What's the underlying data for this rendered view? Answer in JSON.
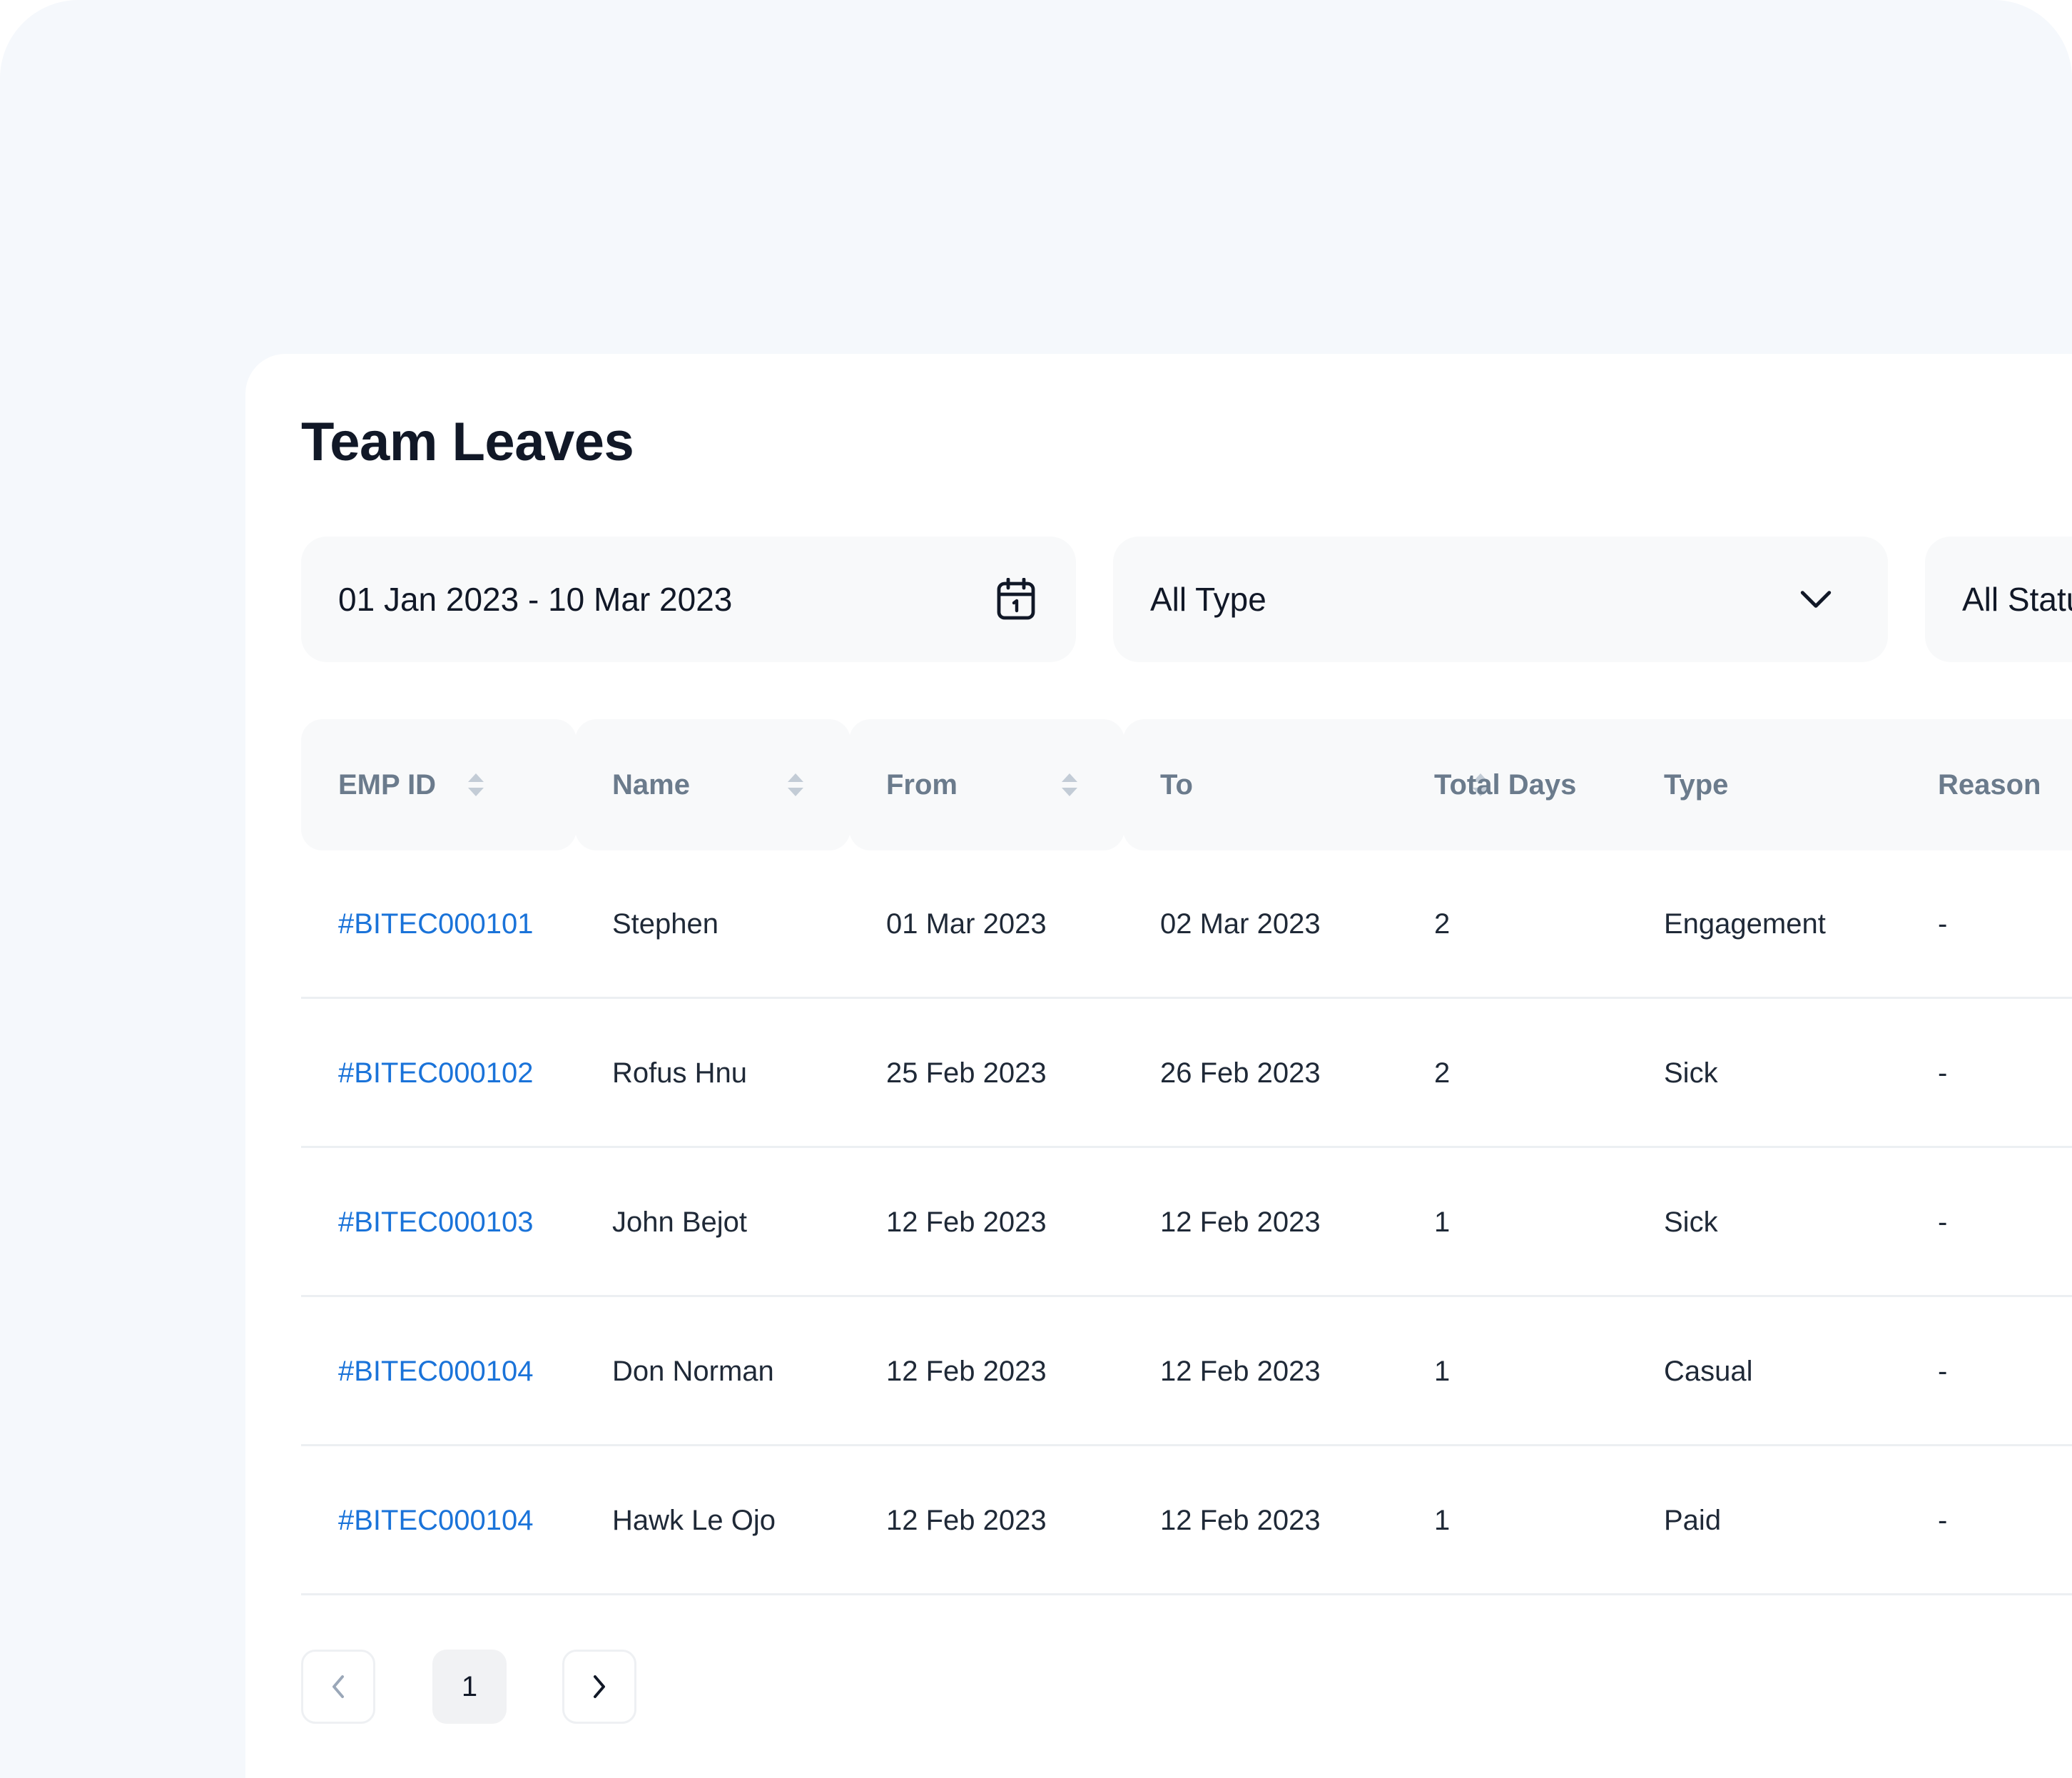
{
  "page": {
    "title": "Team Leaves"
  },
  "filters": {
    "date_range": "01 Jan 2023 - 10 Mar 2023",
    "date_icon": "calendar-icon",
    "type": "All Type",
    "type_icon": "chevron-down-icon",
    "status": "All Statu"
  },
  "table": {
    "columns": [
      "EMP ID",
      "Name",
      "From",
      "To",
      "Total Days",
      "Type",
      "Reason"
    ],
    "rows": [
      {
        "emp_id": "#BITEC000101",
        "name": "Stephen",
        "from": "01 Mar 2023",
        "to": "02 Mar 2023",
        "total_days": "2",
        "type": "Engagement",
        "reason": "-"
      },
      {
        "emp_id": "#BITEC000102",
        "name": "Rofus Hnu",
        "from": "25 Feb 2023",
        "to": "26 Feb 2023",
        "total_days": "2",
        "type": "Sick",
        "reason": "-"
      },
      {
        "emp_id": "#BITEC000103",
        "name": "John Bejot",
        "from": "12 Feb 2023",
        "to": "12 Feb 2023",
        "total_days": "1",
        "type": "Sick",
        "reason": "-"
      },
      {
        "emp_id": "#BITEC000104",
        "name": "Don Norman",
        "from": "12 Feb 2023",
        "to": "12 Feb 2023",
        "total_days": "1",
        "type": "Casual",
        "reason": "-"
      },
      {
        "emp_id": "#BITEC000104",
        "name": "Hawk Le Ojo",
        "from": "12 Feb 2023",
        "to": "12 Feb 2023",
        "total_days": "1",
        "type": "Paid",
        "reason": "-"
      }
    ]
  },
  "pagination": {
    "current_page": "1",
    "prev_icon": "chevron-left-icon",
    "next_icon": "chevron-right-icon"
  },
  "colors": {
    "background": "#f5f8fc",
    "card": "#ffffff",
    "link": "#1a73d9",
    "header_text": "#6b7b8c",
    "title_text": "#111827"
  }
}
